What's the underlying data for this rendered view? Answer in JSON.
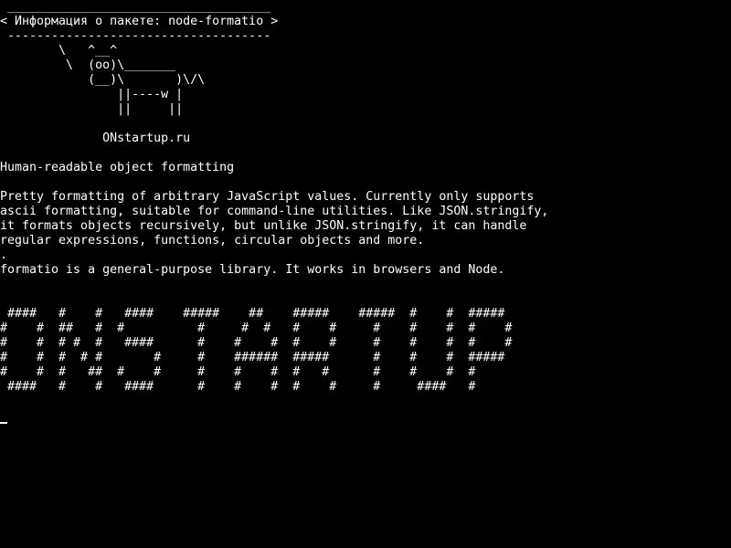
{
  "terminal": {
    "lines": [
      " ____________________________________",
      "< Информация о пакете: node-formatio >",
      " ------------------------------------",
      "        \\   ^__^",
      "         \\  (oo)\\_______",
      "            (__)\\       )\\/\\",
      "                ||----w |",
      "                ||     ||",
      "",
      "              ONstartup.ru",
      "",
      "Human-readable object formatting",
      "",
      "Pretty formatting of arbitrary JavaScript values. Currently only supports",
      "ascii formatting, suitable for command-line utilities. Like JSON.stringify,",
      "it formats objects recursively, but unlike JSON.stringify, it can handle",
      "regular expressions, functions, circular objects and more.",
      ".",
      "formatio is a general-purpose library. It works in browsers and Node.",
      "",
      "",
      " ####   #    #   ####    #####    ##    #####    #####  #    #  #####",
      "#    #  ##   #  #          #     #  #   #    #     #    #    #  #    #",
      "#    #  # #  #   ####      #    #    #  #    #     #    #    #  #    #",
      "#    #  #  # #       #     #    ######  #####      #    #    #  #####",
      "#    #  #   ##  #    #     #    #    #  #   #      #    #    #  #",
      " ####   #    #   ####      #    #    #  #    #     #     ####   #"
    ]
  }
}
